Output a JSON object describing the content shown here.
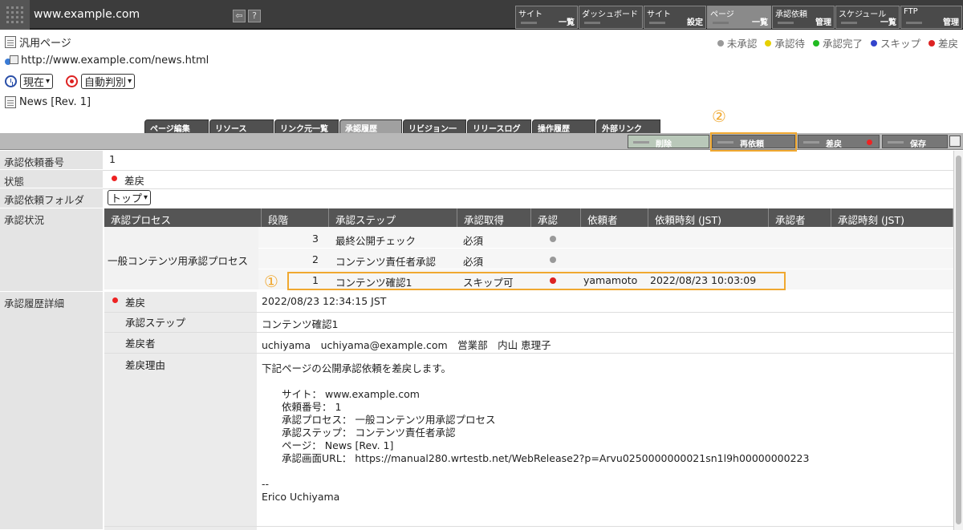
{
  "site": {
    "name": "www.example.com"
  },
  "top_buttons": {
    "back": "⇦",
    "help": "?"
  },
  "nav": [
    {
      "l1": "サイト",
      "l2": "一覧"
    },
    {
      "l1": "ダッシュボード",
      "l2": ""
    },
    {
      "l1": "サイト",
      "l2": "設定"
    },
    {
      "l1": "ページ",
      "l2": "一覧"
    },
    {
      "l1": "承認依頼",
      "l2": "管理"
    },
    {
      "l1": "スケジュール",
      "l2": "一覧"
    },
    {
      "l1": "FTP",
      "l2": "管理"
    }
  ],
  "page": {
    "type": "汎用ページ",
    "url": "http://www.example.com/news.html",
    "time_select": "現在",
    "judge_select": "自動判別",
    "name": "News [Rev. 1]"
  },
  "legend": [
    {
      "label": "未承認",
      "color": "#999999"
    },
    {
      "label": "承認待",
      "color": "#e6d000"
    },
    {
      "label": "承認完了",
      "color": "#22bb22"
    },
    {
      "label": "スキップ",
      "color": "#3344cc"
    },
    {
      "label": "差戻",
      "color": "#dd2222"
    }
  ],
  "tabs": [
    "ページ編集",
    "リソース",
    "リンク元一覧",
    "承認履歴",
    "リビジョン一覧",
    "リリースログ",
    "操作履歴",
    "外部リンク"
  ],
  "actions": {
    "delete": "削除",
    "rerequest": "再依頼",
    "reject": "差戻",
    "save": "保存"
  },
  "annot": {
    "one": "①",
    "two": "②"
  },
  "detail": {
    "req_no_label": "承認依頼番号",
    "req_no": "1",
    "status_label": "状態",
    "status": "差戻",
    "folder_label": "承認依頼フォルダ",
    "folder": "トップ",
    "approval_label": "承認状況",
    "history_label": "承認履歴詳細"
  },
  "process_table": {
    "headers": [
      "承認プロセス",
      "段階",
      "承認ステップ",
      "承認取得",
      "承認",
      "依頼者",
      "依頼時刻 (JST)",
      "承認者",
      "承認時刻 (JST)"
    ],
    "process_name": "一般コンテンツ用承認プロセス",
    "rows": [
      {
        "stage": "3",
        "step": "最終公開チェック",
        "get": "必須",
        "requester": "",
        "time": ""
      },
      {
        "stage": "2",
        "step": "コンテンツ責任者承認",
        "get": "必須",
        "requester": "",
        "time": ""
      },
      {
        "stage": "1",
        "step": "コンテンツ確認1",
        "get": "スキップ可",
        "requester": "yamamoto",
        "time": "2022/08/23 10:03:09"
      }
    ]
  },
  "history": {
    "status": "差戻",
    "time": "2022/08/23 12:34:15 JST",
    "step_label": "承認ステップ",
    "step": "コンテンツ確認1",
    "by_label": "差戻者",
    "by": "uchiyama　uchiyama@example.com　営業部　内山 恵理子",
    "reason_label": "差戻理由",
    "reason_lines": [
      "下記ページの公開承認依頼を差戻します。",
      "",
      "　　サイト： www.example.com",
      "　　依頼番号： 1",
      "　　承認プロセス： 一般コンテンツ用承認プロセス",
      "　　承認ステップ： コンテンツ責任者承認",
      "　　ページ： News [Rev. 1]",
      "　　承認画面URL： https://manual280.wrtestb.net/WebRelease2?p=Arvu0250000000021sn1l9h00000000223",
      "",
      "--",
      "Erico Uchiyama"
    ]
  }
}
